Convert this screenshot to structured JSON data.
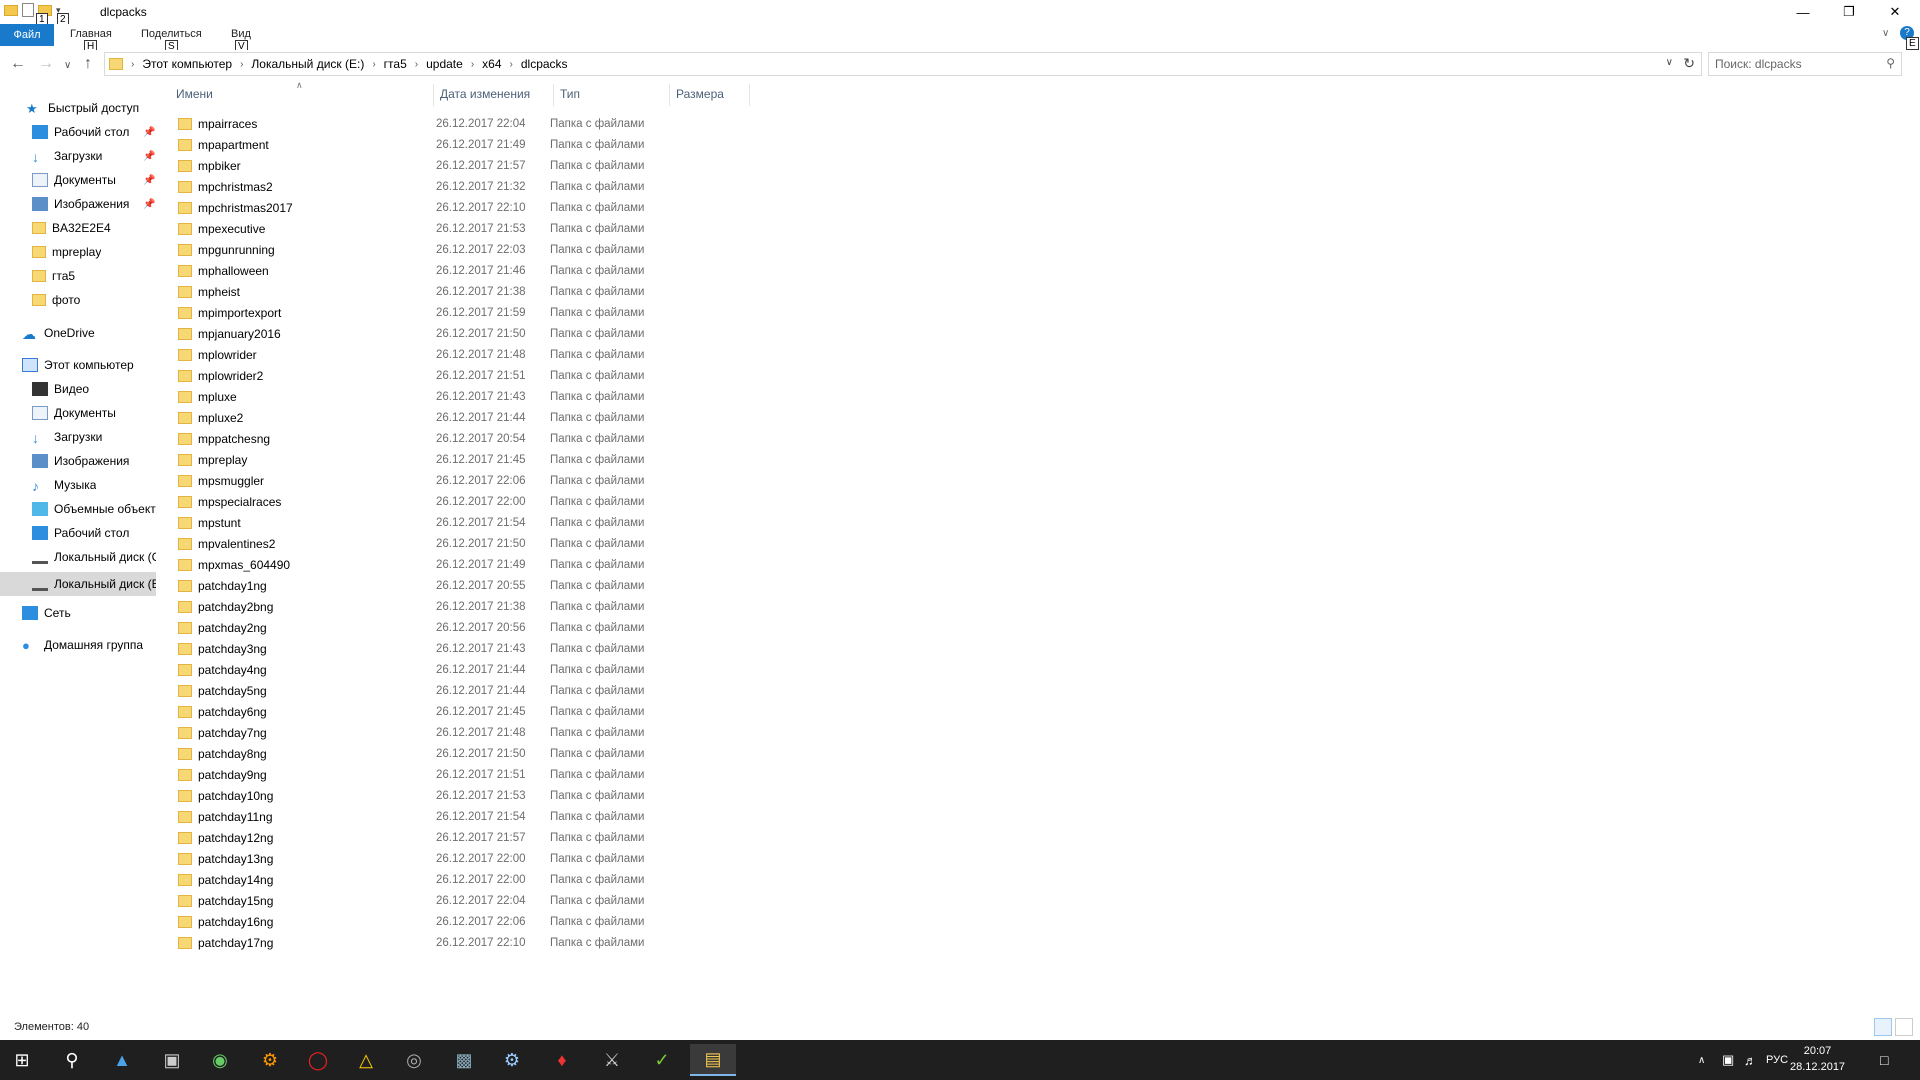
{
  "window": {
    "title": "dlcpacks",
    "keytips": [
      "1",
      "2",
      "H",
      "S",
      "V",
      "E"
    ]
  },
  "ribbon": {
    "file_tab": "Файл",
    "tabs": [
      "Главная",
      "Поделиться",
      "Вид"
    ]
  },
  "address": {
    "crumbs": [
      "Этот компьютер",
      "Локальный диск (E:)",
      "гта5",
      "update",
      "x64",
      "dlcpacks"
    ]
  },
  "search": {
    "placeholder": "Поиск: dlcpacks"
  },
  "sidebar": {
    "quick_access": "Быстрый доступ",
    "quick_items": [
      "Рабочий стол",
      "Загрузки",
      "Документы",
      "Изображения",
      "BA32E2E4",
      "mpreplay",
      "гта5",
      "фото"
    ],
    "onedrive": "OneDrive",
    "this_pc": "Этот компьютер",
    "pc_items": [
      "Видео",
      "Документы",
      "Загрузки",
      "Изображения",
      "Музыка",
      "Объемные объекты",
      "Рабочий стол",
      "Локальный диск (C",
      "Локальный диск (E"
    ],
    "network": "Сеть",
    "homegroup": "Домашняя группа"
  },
  "columns": {
    "name": "Имени",
    "date": "Дата изменения",
    "type": "Тип",
    "size": "Размера"
  },
  "files": [
    {
      "name": "mpairraces",
      "date": "26.12.2017 22:04",
      "type": "Папка с файлами"
    },
    {
      "name": "mpapartment",
      "date": "26.12.2017 21:49",
      "type": "Папка с файлами"
    },
    {
      "name": "mpbiker",
      "date": "26.12.2017 21:57",
      "type": "Папка с файлами"
    },
    {
      "name": "mpchristmas2",
      "date": "26.12.2017 21:32",
      "type": "Папка с файлами"
    },
    {
      "name": "mpchristmas2017",
      "date": "26.12.2017 22:10",
      "type": "Папка с файлами"
    },
    {
      "name": "mpexecutive",
      "date": "26.12.2017 21:53",
      "type": "Папка с файлами"
    },
    {
      "name": "mpgunrunning",
      "date": "26.12.2017 22:03",
      "type": "Папка с файлами"
    },
    {
      "name": "mphalloween",
      "date": "26.12.2017 21:46",
      "type": "Папка с файлами"
    },
    {
      "name": "mpheist",
      "date": "26.12.2017 21:38",
      "type": "Папка с файлами"
    },
    {
      "name": "mpimportexport",
      "date": "26.12.2017 21:59",
      "type": "Папка с файлами"
    },
    {
      "name": "mpjanuary2016",
      "date": "26.12.2017 21:50",
      "type": "Папка с файлами"
    },
    {
      "name": "mplowrider",
      "date": "26.12.2017 21:48",
      "type": "Папка с файлами"
    },
    {
      "name": "mplowrider2",
      "date": "26.12.2017 21:51",
      "type": "Папка с файлами"
    },
    {
      "name": "mpluxe",
      "date": "26.12.2017 21:43",
      "type": "Папка с файлами"
    },
    {
      "name": "mpluxe2",
      "date": "26.12.2017 21:44",
      "type": "Папка с файлами"
    },
    {
      "name": "mppatchesng",
      "date": "26.12.2017 20:54",
      "type": "Папка с файлами"
    },
    {
      "name": "mpreplay",
      "date": "26.12.2017 21:45",
      "type": "Папка с файлами"
    },
    {
      "name": "mpsmuggler",
      "date": "26.12.2017 22:06",
      "type": "Папка с файлами"
    },
    {
      "name": "mpspecialraces",
      "date": "26.12.2017 22:00",
      "type": "Папка с файлами"
    },
    {
      "name": "mpstunt",
      "date": "26.12.2017 21:54",
      "type": "Папка с файлами"
    },
    {
      "name": "mpvalentines2",
      "date": "26.12.2017 21:50",
      "type": "Папка с файлами"
    },
    {
      "name": "mpxmas_604490",
      "date": "26.12.2017 21:49",
      "type": "Папка с файлами"
    },
    {
      "name": "patchday1ng",
      "date": "26.12.2017 20:55",
      "type": "Папка с файлами"
    },
    {
      "name": "patchday2bng",
      "date": "26.12.2017 21:38",
      "type": "Папка с файлами"
    },
    {
      "name": "patchday2ng",
      "date": "26.12.2017 20:56",
      "type": "Папка с файлами"
    },
    {
      "name": "patchday3ng",
      "date": "26.12.2017 21:43",
      "type": "Папка с файлами"
    },
    {
      "name": "patchday4ng",
      "date": "26.12.2017 21:44",
      "type": "Папка с файлами"
    },
    {
      "name": "patchday5ng",
      "date": "26.12.2017 21:44",
      "type": "Папка с файлами"
    },
    {
      "name": "patchday6ng",
      "date": "26.12.2017 21:45",
      "type": "Папка с файлами"
    },
    {
      "name": "patchday7ng",
      "date": "26.12.2017 21:48",
      "type": "Папка с файлами"
    },
    {
      "name": "patchday8ng",
      "date": "26.12.2017 21:50",
      "type": "Папка с файлами"
    },
    {
      "name": "patchday9ng",
      "date": "26.12.2017 21:51",
      "type": "Папка с файлами"
    },
    {
      "name": "patchday10ng",
      "date": "26.12.2017 21:53",
      "type": "Папка с файлами"
    },
    {
      "name": "patchday11ng",
      "date": "26.12.2017 21:54",
      "type": "Папка с файлами"
    },
    {
      "name": "patchday12ng",
      "date": "26.12.2017 21:57",
      "type": "Папка с файлами"
    },
    {
      "name": "patchday13ng",
      "date": "26.12.2017 22:00",
      "type": "Папка с файлами"
    },
    {
      "name": "patchday14ng",
      "date": "26.12.2017 22:00",
      "type": "Папка с файлами"
    },
    {
      "name": "patchday15ng",
      "date": "26.12.2017 22:04",
      "type": "Папка с файлами"
    },
    {
      "name": "patchday16ng",
      "date": "26.12.2017 22:06",
      "type": "Папка с файлами"
    },
    {
      "name": "patchday17ng",
      "date": "26.12.2017 22:10",
      "type": "Папка с файлами"
    }
  ],
  "status": {
    "items": "Элементов: 40"
  },
  "tray": {
    "lang": "РУС",
    "time": "20:07",
    "date": "28.12.2017"
  },
  "colors": {
    "accent": "#1979ca",
    "folder": "#f8d775",
    "taskbar": "#1f1f1f"
  }
}
